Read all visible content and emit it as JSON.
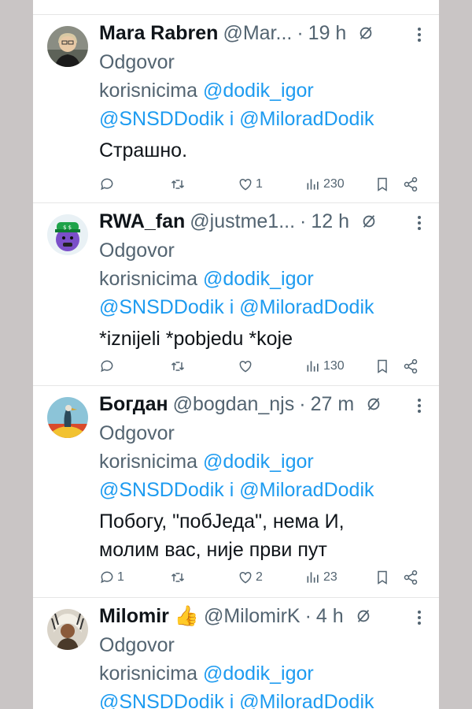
{
  "reply_prefix": "Odgovor",
  "reply_to_label": "korisnicima",
  "reply_mentions": [
    "@dodik_igor",
    "@SNSDDodik",
    "i",
    "@MiloradDodik"
  ],
  "colors": {
    "link": "#1d9bf0",
    "text": "#0f1419",
    "secondary": "#536471",
    "page_bg": "#c9c5c5"
  },
  "tweets": [
    {
      "name": "Mara Rabren",
      "handle": "@Mar...",
      "time": "19 h",
      "body": [
        "Страшно."
      ],
      "replies": "",
      "likes": "1",
      "views": "230",
      "avatar": "photo-woman-glasses"
    },
    {
      "name": "RWA_fan",
      "handle": "@justme1...",
      "time": "12 h",
      "body": [
        "*iznijeli *pobjedu *koje"
      ],
      "replies": "",
      "likes": "",
      "views": "130",
      "avatar": "cartoon-purple-character"
    },
    {
      "name": "Богдан",
      "handle": "@bogdan_njs",
      "time": "27 m",
      "body": [
        "Побогу, \"побЈеда\", нема И,",
        "молим вас, није први пут"
      ],
      "replies": "1",
      "likes": "2",
      "views": "23",
      "avatar": "bird-illustration"
    },
    {
      "name": "Milomir 👍",
      "handle": "@MilomirK",
      "time": "4 h",
      "body": [],
      "replies": "",
      "likes": "",
      "views": "",
      "avatar": "native-headdress-portrait"
    }
  ]
}
